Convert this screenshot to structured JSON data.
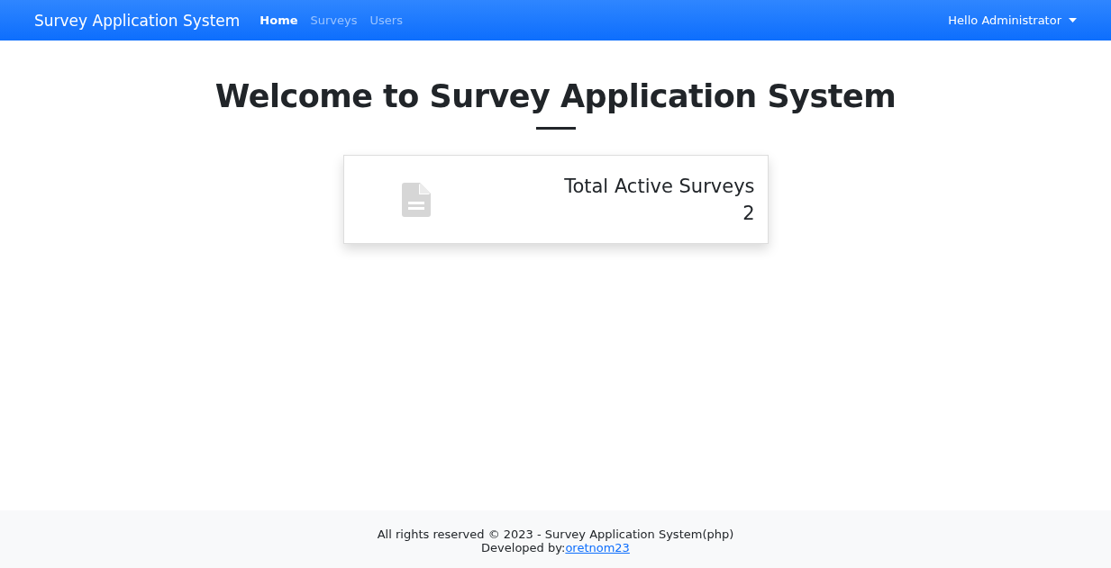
{
  "navbar": {
    "brand": "Survey Application System",
    "links": [
      {
        "label": "Home",
        "selected": true
      },
      {
        "label": "Surveys",
        "selected": false
      },
      {
        "label": "Users",
        "selected": false
      }
    ],
    "user_menu": "Hello Administrator"
  },
  "heading": "Welcome to Survey Application System",
  "stat_card": {
    "label": "Total Active Surveys",
    "value": "2"
  },
  "footer": {
    "copyright": "All rights reserved © 2023 - Survey Application System(php)",
    "developer_prefix": "Developed by:",
    "developer_link": "oretnom23"
  }
}
